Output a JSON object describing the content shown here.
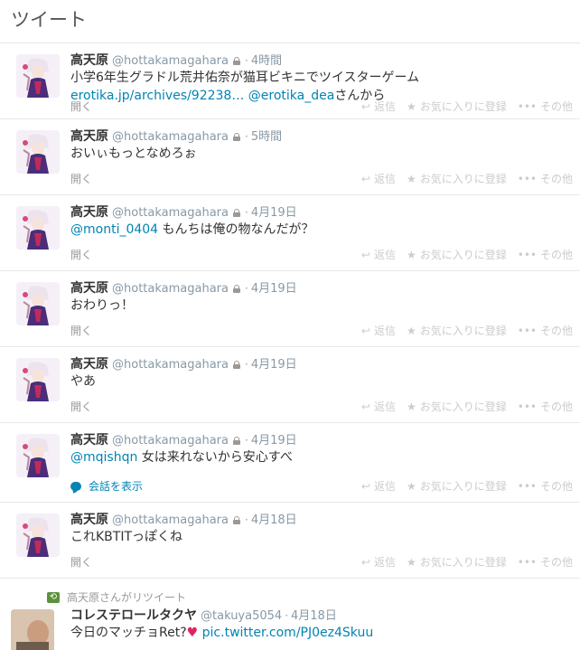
{
  "header": {
    "title": "ツイート"
  },
  "user": {
    "name": "高天原",
    "screen": "@hottakamagahara"
  },
  "actions": {
    "reply": "返信",
    "fav": "お気に入りに登録",
    "more": "その他",
    "expand": "開く"
  },
  "tweets": [
    {
      "time": "4時間",
      "text": "小学6年生グラドル荒井佑奈が猫耳ビキニでツイスターゲーム",
      "link1": "erotika.jp/archives/92238…",
      "link2": "@erotika_dea",
      "suffix": "さんから"
    },
    {
      "time": "5時間",
      "text": "おいぃもっとなめろぉ"
    },
    {
      "time": "4月19日",
      "mention": "@monti_0404",
      "text": " もんちは俺の物なんだが？"
    },
    {
      "time": "4月19日",
      "text": "おわりっ！"
    },
    {
      "time": "4月19日",
      "text": "やあ"
    },
    {
      "time": "4月19日",
      "mention": "@mqishqn",
      "text": " 女は来れないから安心すべ",
      "convo": "会話を表示"
    },
    {
      "time": "4月18日",
      "text": "これKBTITっぽくね"
    }
  ],
  "retweet": {
    "label": "高天原さんがリツイート",
    "name": "コレステロールタクヤ",
    "screen": "@takuya5054",
    "time": "4月18日",
    "text": "今日のマッチョRet?",
    "link": "pic.twitter.com/PJ0ez4Skuu"
  }
}
